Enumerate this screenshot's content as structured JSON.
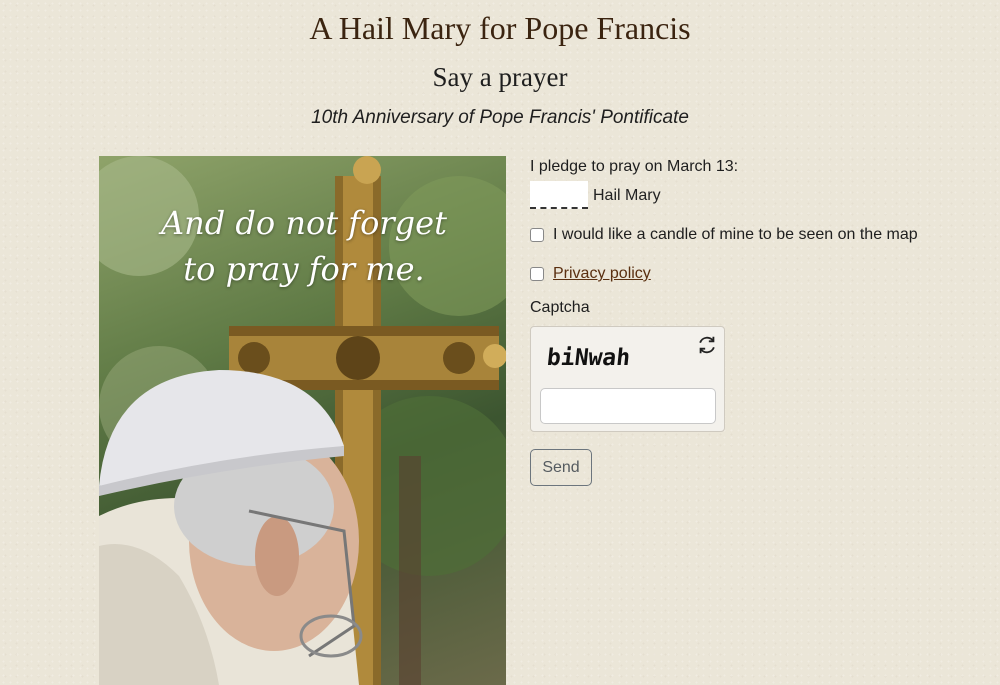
{
  "page": {
    "title": "A Hail Mary for Pope Francis",
    "subtitle": "Say a prayer",
    "tagline": "10th Anniversary of Pope Francis' Pontificate"
  },
  "image": {
    "quote_line1": "And do not forget",
    "quote_line2": "to pray for me."
  },
  "form": {
    "pledge_label": "I pledge to pray on March 13:",
    "pledge_value": "",
    "pledge_unit": "Hail Mary",
    "candle_label": "I would like a candle of mine to be seen on the map",
    "candle_checked": false,
    "privacy_label": "Privacy policy",
    "privacy_checked": false,
    "captcha_label": "Captcha",
    "captcha_text": "biNwah",
    "captcha_value": "",
    "send_label": "Send"
  },
  "colors": {
    "background": "#ebe6d8",
    "title": "#3b2410",
    "link": "#5a2f10"
  },
  "icons": {
    "captcha_refresh": "refresh-icon"
  }
}
